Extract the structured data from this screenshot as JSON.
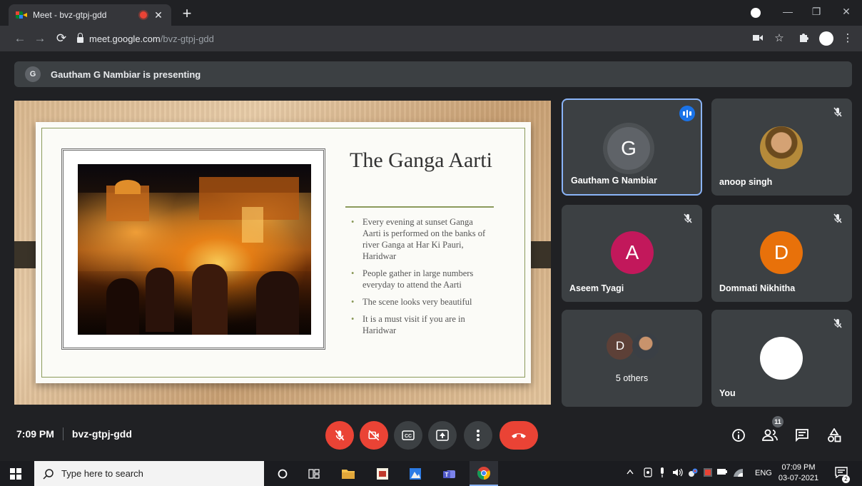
{
  "browser": {
    "tab_title": "Meet - bvz-gtpj-gdd",
    "url_host": "meet.google.com",
    "url_path": "/bvz-gtpj-gdd"
  },
  "presenting": {
    "initial": "G",
    "text": "Gautham G Nambiar is presenting"
  },
  "slide": {
    "title": "The Ganga Aarti",
    "bullets": [
      "Every evening at sunset Ganga Aarti is performed on the banks of river Ganga at Har Ki Pauri, Haridwar",
      "People gather in large numbers everyday to attend the Aarti",
      "The scene looks very beautiful",
      "It is a must visit if you are in Haridwar"
    ]
  },
  "participants": [
    {
      "name": "Gautham G Nambiar",
      "initial": "G",
      "color": "#5f6368",
      "speaking": true,
      "muted": false
    },
    {
      "name": "anoop singh",
      "initial": "",
      "color": "#a07a2c",
      "speaking": false,
      "muted": true
    },
    {
      "name": "Aseem Tyagi",
      "initial": "A",
      "color": "#c2185b",
      "speaking": false,
      "muted": true
    },
    {
      "name": "Dommati Nikhitha",
      "initial": "D",
      "color": "#e8710a",
      "speaking": false,
      "muted": true
    },
    {
      "name": "5 others",
      "initial": "D",
      "color": "#5d4037",
      "speaking": false,
      "muted": false
    },
    {
      "name": "You",
      "initial": "",
      "color": "#ffffff",
      "speaking": false,
      "muted": true
    }
  ],
  "meeting": {
    "time": "7:09 PM",
    "code": "bvz-gtpj-gdd",
    "participant_count": "11"
  },
  "taskbar": {
    "search_placeholder": "Type here to search",
    "language": "ENG",
    "time": "07:09 PM",
    "date": "03-07-2021",
    "notifications": "2"
  },
  "colors": {
    "accent": "#8ab4f8",
    "danger": "#ea4335",
    "surface": "#3c4043",
    "background": "#202124"
  }
}
